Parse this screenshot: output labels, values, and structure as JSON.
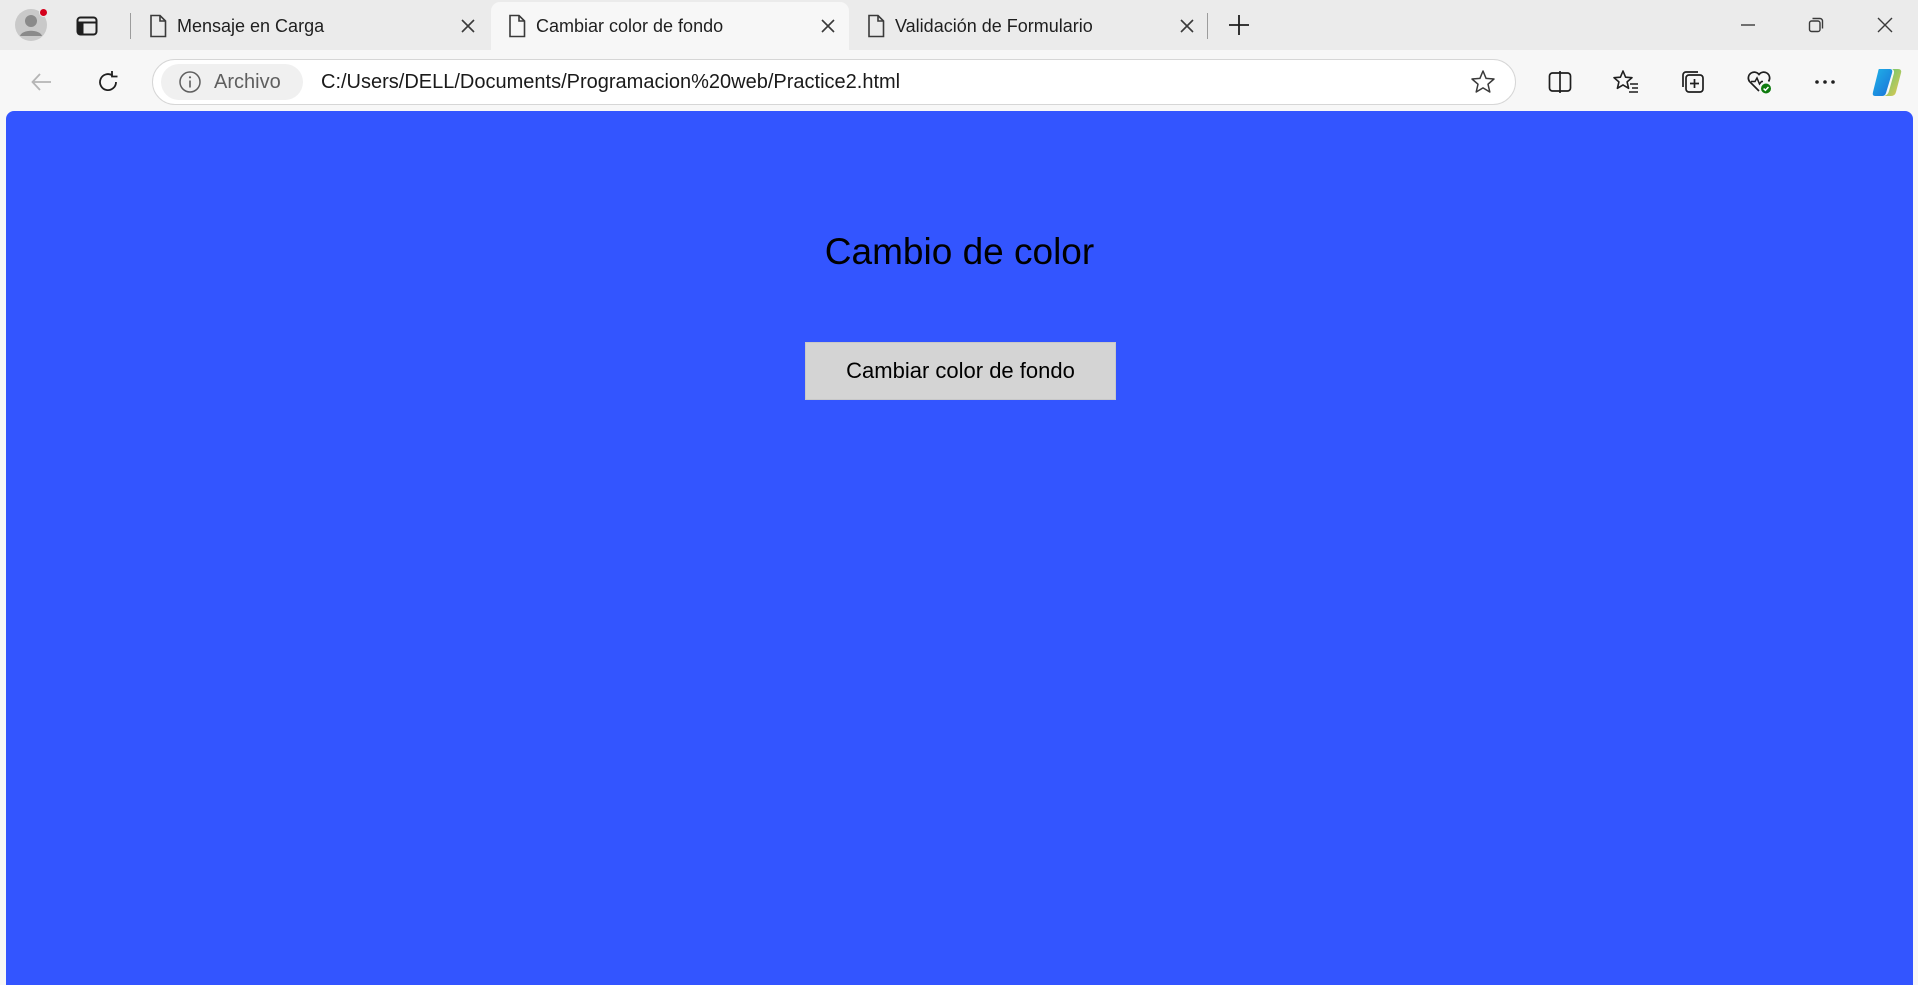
{
  "browser": {
    "tabs": [
      {
        "title": "Mensaje en Carga",
        "active": false
      },
      {
        "title": "Cambiar color de fondo",
        "active": true
      },
      {
        "title": "Validación de Formulario",
        "active": false
      }
    ],
    "site_info_label": "Archivo",
    "url": "C:/Users/DELL/Documents/Programacion%20web/Practice2.html",
    "icons": [
      "profile-icon",
      "tab-actions-icon",
      "page-icon",
      "close-icon",
      "new-tab-icon",
      "minimize-icon",
      "restore-icon",
      "window-close-icon",
      "back-icon",
      "refresh-icon",
      "info-icon",
      "favorite-star-icon",
      "split-screen-icon",
      "favorites-icon",
      "collections-icon",
      "browser-essentials-icon",
      "more-icon",
      "copilot-icon"
    ]
  },
  "page": {
    "background_color": "#3355ff",
    "heading": "Cambio de color",
    "button_label": "Cambiar color de fondo",
    "button_color": "#d4d4d4"
  }
}
